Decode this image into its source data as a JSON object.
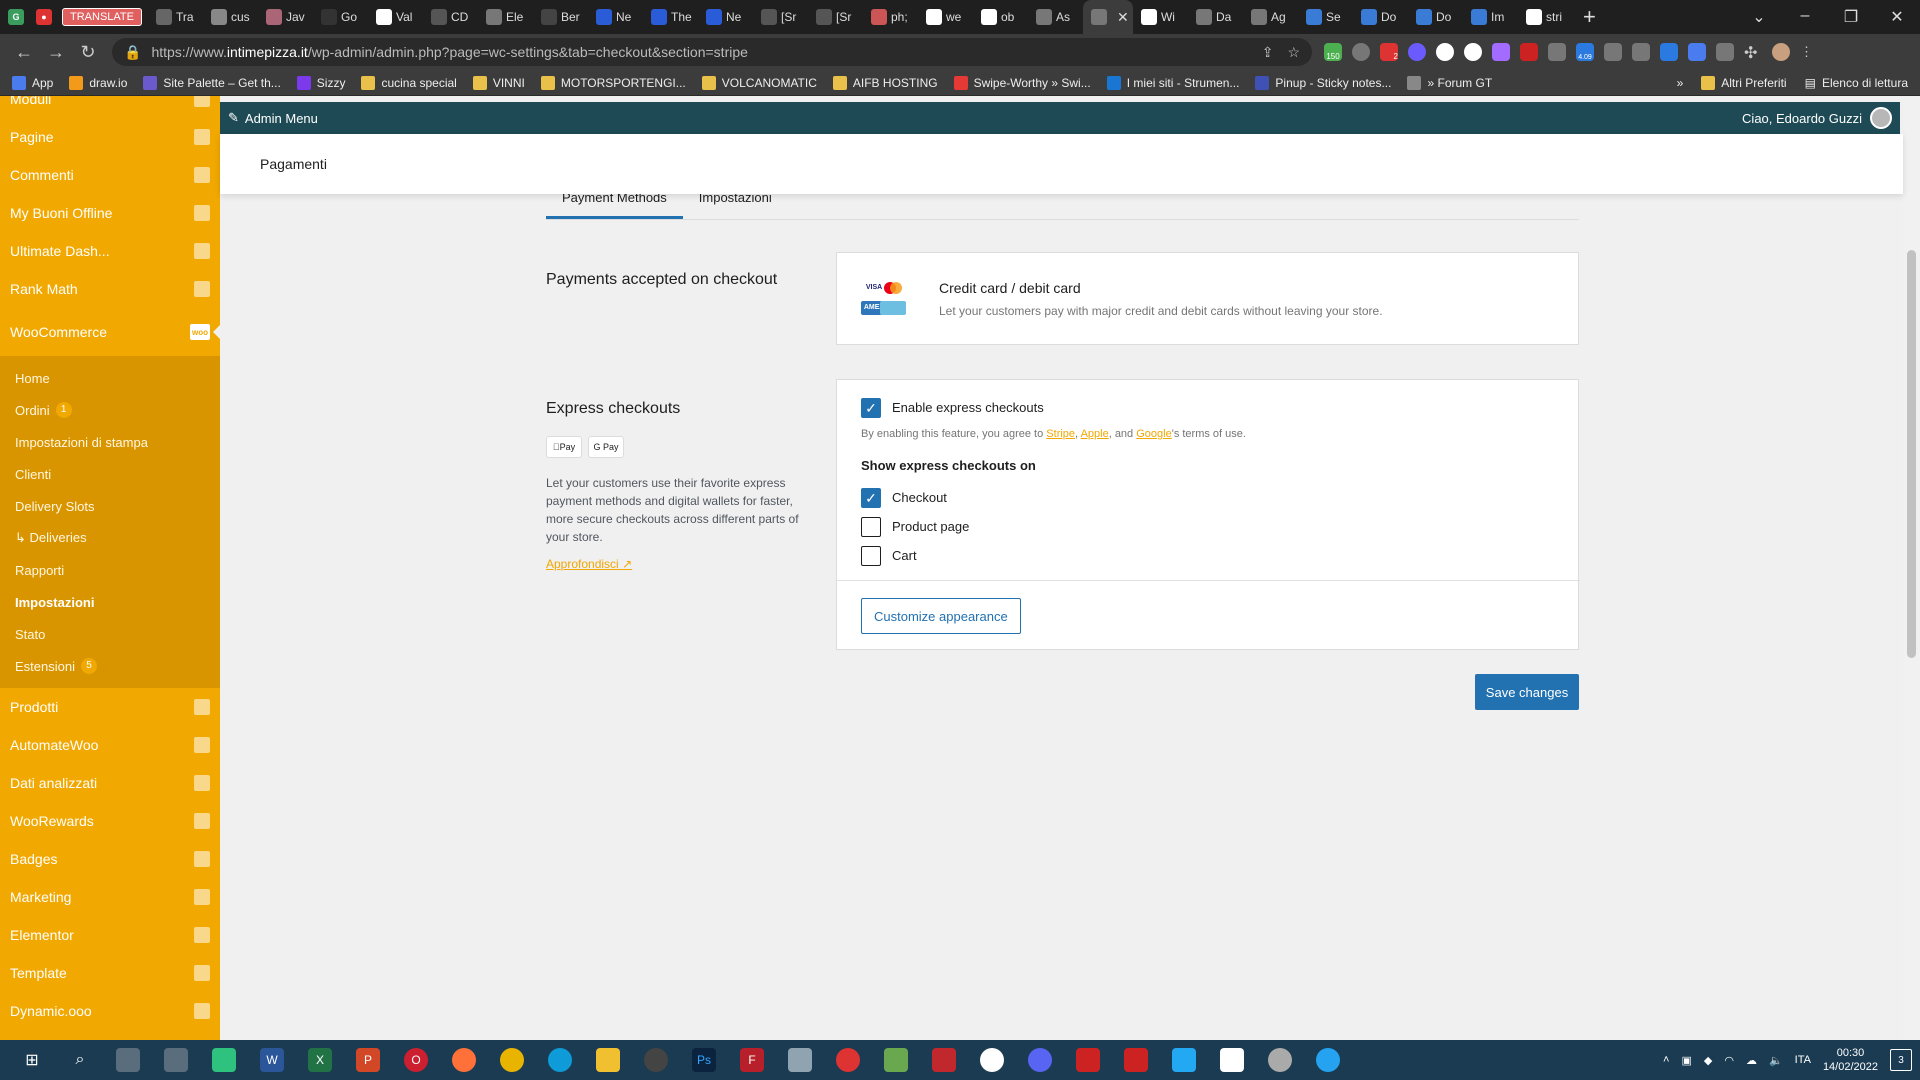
{
  "browser": {
    "translate_label": "TRANSLATE",
    "tabs": [
      {
        "title": "Tra"
      },
      {
        "title": "cus"
      },
      {
        "title": "Jav"
      },
      {
        "title": "Go"
      },
      {
        "title": "Val"
      },
      {
        "title": "CD"
      },
      {
        "title": "Ele"
      },
      {
        "title": "Ber"
      },
      {
        "title": "Ne"
      },
      {
        "title": "The"
      },
      {
        "title": "Ne"
      },
      {
        "title": "[Sr"
      },
      {
        "title": "[Sr"
      },
      {
        "title": "ph;"
      },
      {
        "title": "we"
      },
      {
        "title": "ob"
      },
      {
        "title": "As"
      },
      {
        "title": ""
      },
      {
        "title": "Wi"
      },
      {
        "title": "Da"
      },
      {
        "title": "Ag"
      },
      {
        "title": "Se"
      },
      {
        "title": "Do"
      },
      {
        "title": "Do"
      },
      {
        "title": "Im"
      },
      {
        "title": "stri"
      }
    ],
    "url_prefix": "https://www.",
    "url_host": "intimepizza.it",
    "url_path": "/wp-admin/admin.php?page=wc-settings&tab=checkout&section=stripe",
    "extension_badges": {
      "a": "150",
      "b": "2",
      "c": "4.09"
    }
  },
  "bookmarks": {
    "items": [
      "App",
      "draw.io",
      "Site Palette – Get th...",
      "Sizzy",
      "cucina special",
      "VINNI",
      "MOTORSPORTENGI...",
      "VOLCANOMATIC",
      "AIFB HOSTING",
      "Swipe-Worthy » Swi...",
      "I miei siti - Strumen...",
      "Pinup - Sticky notes...",
      "» Forum GT"
    ],
    "overflow": "»",
    "other_favorites": "Altri Preferiti",
    "reading_list": "Elenco di lettura"
  },
  "adminbar": {
    "menu_label": "Admin Menu",
    "greeting": "Ciao, Edoardo Guzzi"
  },
  "sidebar": {
    "top_items": [
      "Moduli",
      "Pagine",
      "Commenti",
      "My Buoni Offline",
      "Ultimate Dash...",
      "Rank Math"
    ],
    "woocommerce": "WooCommerce",
    "woo_icon": "woo",
    "submenu": [
      {
        "label": "Home"
      },
      {
        "label": "Ordini",
        "badge": "1"
      },
      {
        "label": "Impostazioni di stampa"
      },
      {
        "label": "Clienti"
      },
      {
        "label": "Delivery Slots"
      },
      {
        "label": "↳ Deliveries"
      },
      {
        "label": "Rapporti"
      },
      {
        "label": "Impostazioni"
      },
      {
        "label": "Stato"
      },
      {
        "label": "Estensioni",
        "badge": "5"
      }
    ],
    "bottom_items": [
      "Prodotti",
      "AutomateWoo",
      "Dati analizzati",
      "WooRewards",
      "Badges",
      "Marketing",
      "Elementor",
      "Template",
      "Dynamic.ooo"
    ]
  },
  "page": {
    "heading": "Pagamenti",
    "tabs": [
      "Payment Methods",
      "Impostazioni"
    ],
    "payments_section": {
      "title": "Payments accepted on checkout",
      "card_title": "Credit card / debit card",
      "card_desc": "Let your customers pay with major credit and debit cards without leaving your store.",
      "logos": {
        "visa": "VISA",
        "amex": "AMEX"
      }
    },
    "express_section": {
      "title": "Express checkouts",
      "pills": [
        "Pay",
        "G Pay"
      ],
      "desc": "Let your customers use their favorite express payment methods and digital wallets for faster, more secure checkouts across different parts of your store.",
      "learn_more": "Approfondisci",
      "enable_label": "Enable express checkouts",
      "terms_prefix": "By enabling this feature, you agree to ",
      "terms_stripe": "Stripe",
      "terms_sep1": ", ",
      "terms_apple": "Apple",
      "terms_sep2": ", and ",
      "terms_google": "Google",
      "terms_suffix": "'s terms of use.",
      "show_on_title": "Show express checkouts on",
      "options": [
        {
          "label": "Checkout",
          "checked": true
        },
        {
          "label": "Product page",
          "checked": false
        },
        {
          "label": "Cart",
          "checked": false
        }
      ],
      "customize_button": "Customize appearance"
    },
    "save_button": "Save changes"
  },
  "taskbar": {
    "language": "ITA",
    "time": "00:30",
    "date": "14/02/2022",
    "notifications": "3"
  },
  "colors": {
    "sidebar": "#f1a800",
    "adminbar": "#1d4a55",
    "primary": "#2271b1"
  }
}
